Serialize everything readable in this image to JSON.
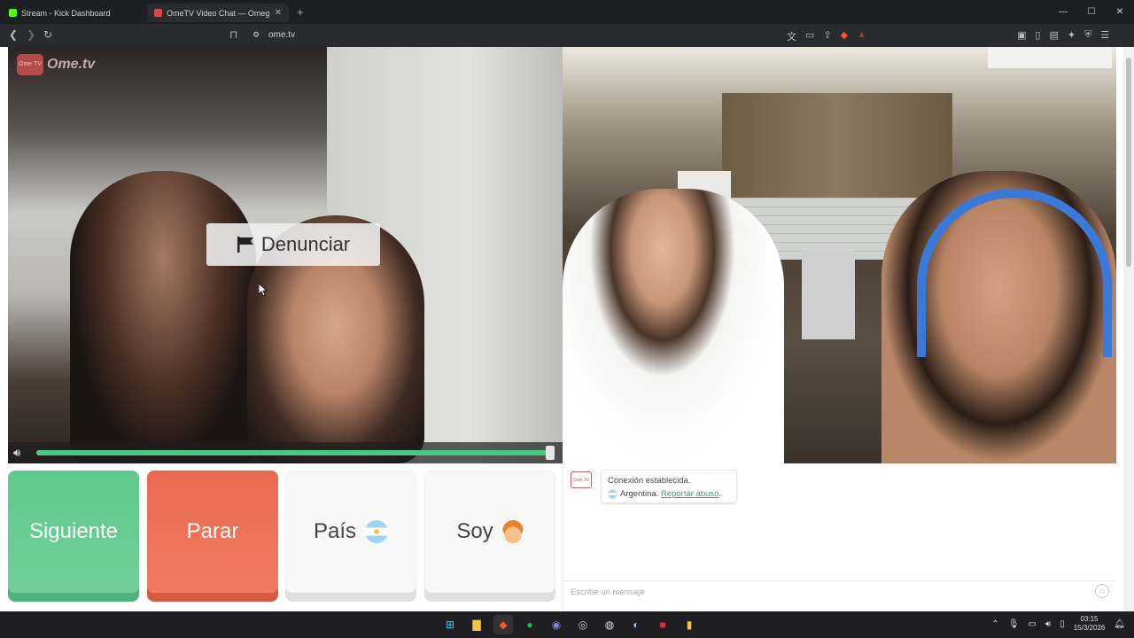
{
  "browser": {
    "tabs": [
      {
        "title": "Stream - Kick Dashboard",
        "favicon_color": "#53fc18"
      },
      {
        "title": "OmeTV Video Chat — Omeg",
        "favicon_color": "#d94b4b"
      }
    ],
    "new_tab": "+",
    "url": "ome.tv",
    "window_controls": {
      "minimize": "—",
      "maximize": "☐",
      "close": "✕"
    }
  },
  "app": {
    "logo_text": "Ome.tv",
    "logo_badge": "Ome TV",
    "report_button": "Denunciar",
    "buttons": {
      "next": "Siguiente",
      "stop": "Parar",
      "country": "País",
      "gender": "Soy"
    },
    "chat": {
      "system_message": "Conexión establecida.",
      "country": "Argentina.",
      "report_link": "Reportar abuso",
      "input_placeholder": "Escribe un mensaje"
    },
    "volume_level": 1.0
  },
  "taskbar": {
    "time": "03:15",
    "date": "15/3/2026"
  },
  "colors": {
    "next": "#5fc98c",
    "stop": "#ea6a50",
    "link": "#3a9f8a"
  }
}
